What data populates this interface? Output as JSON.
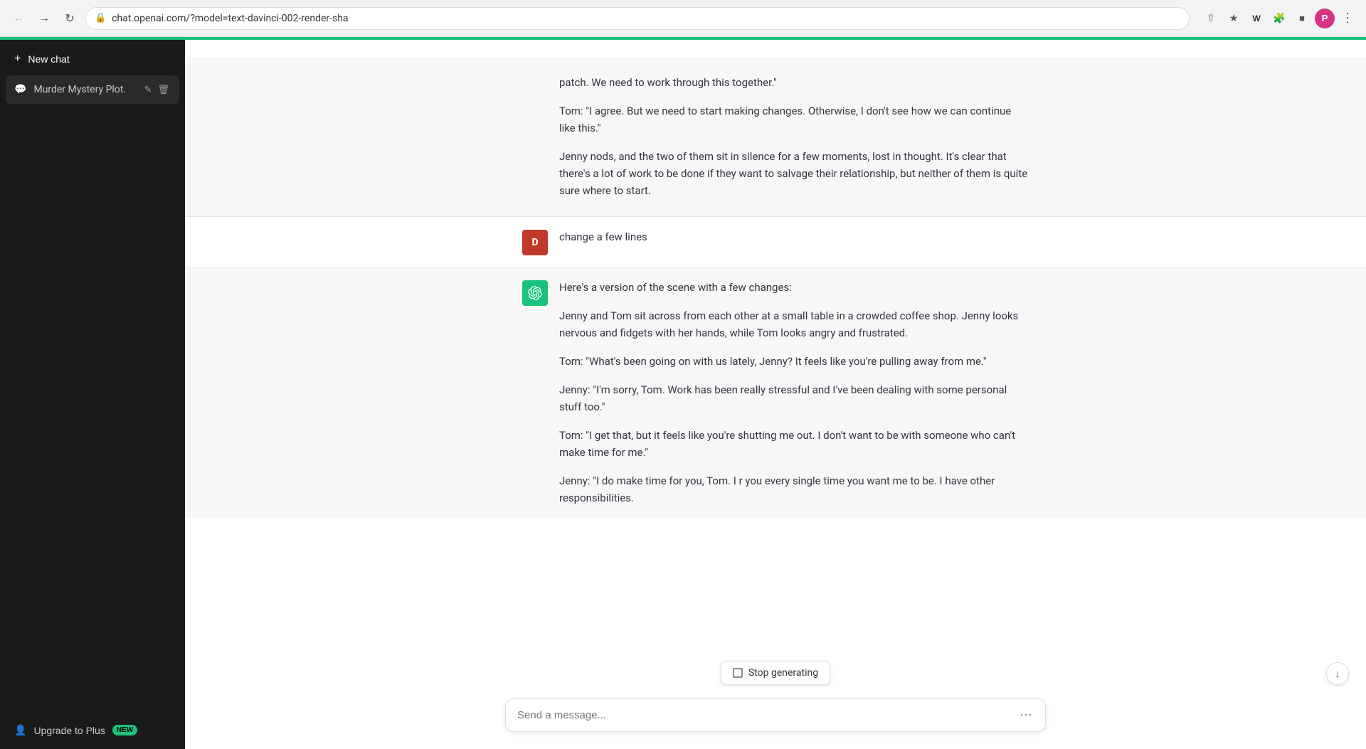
{
  "browser": {
    "url": "chat.openai.com/?model=text-davinci-002-render-sha",
    "back_disabled": true,
    "profile_letter": "P"
  },
  "sidebar": {
    "new_chat_label": "New chat",
    "chat_item_label": "Murder Mystery Plot.",
    "upgrade_label": "Upgrade to Plus",
    "upgrade_badge": "NEW"
  },
  "chat": {
    "prior_text_p1": "patch. We need to work through this together.\"",
    "prior_text_p2": "Tom: \"I agree. But we need to start making changes. Otherwise, I don't see how we can continue like this.\"",
    "prior_text_p3": "Jenny nods, and the two of them sit in silence for a few moments, lost in thought. It's clear that there's a lot of work to be done if they want to salvage their relationship, but neither of them is quite sure where to start.",
    "user_message": "change a few lines",
    "user_avatar": "D",
    "assistant_avatar": "⚙",
    "assistant_intro": "Here's a version of the scene with a few changes:",
    "assistant_p1": "Jenny and Tom sit across from each other at a small table in a crowded coffee shop. Jenny looks nervous and fidgets with her hands, while Tom looks angry and frustrated.",
    "assistant_p2": "Tom: \"What's been going on with us lately, Jenny? It feels like you're pulling away from me.\"",
    "assistant_p3": "Jenny: \"I'm sorry, Tom. Work has been really stressful and I've been dealing with some personal stuff too.\"",
    "assistant_p4": "Tom: \"I get that, but it feels like you're shutting me out. I don't want to be with someone who can't make time for me.\"",
    "assistant_p5": "Jenny: \"I do make time for you, Tom. I r you every single time you want me to be. I have other responsibilities.",
    "stop_generating_label": "Stop generating",
    "input_placeholder": "Send a message..."
  }
}
